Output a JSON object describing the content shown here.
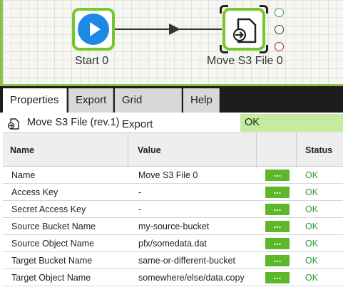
{
  "canvas": {
    "nodes": [
      {
        "label": "Start 0",
        "icon": "play-icon"
      },
      {
        "label": "Move S3 File 0",
        "icon": "move-file-icon"
      }
    ]
  },
  "tabs": [
    {
      "label": "Properties",
      "active": true
    },
    {
      "label": "Export"
    },
    {
      "label": "Grid Export"
    },
    {
      "label": "Help"
    }
  ],
  "component": {
    "title": "Move S3 File (rev.1)",
    "status": "OK"
  },
  "table": {
    "headers": {
      "name": "Name",
      "value": "Value",
      "button": "",
      "status": "Status"
    },
    "rows": [
      {
        "name": "Name",
        "value": "Move S3 File 0",
        "button": "...",
        "status": "OK"
      },
      {
        "name": "Access Key",
        "value": "-",
        "button": "...",
        "status": "OK"
      },
      {
        "name": "Secret Access Key",
        "value": "-",
        "button": "...",
        "status": "OK"
      },
      {
        "name": "Source Bucket Name",
        "value": "my-source-bucket",
        "button": "...",
        "status": "OK"
      },
      {
        "name": "Source Object Name",
        "value": "pfx/somedata.dat",
        "button": "...",
        "status": "OK"
      },
      {
        "name": "Target Bucket Name",
        "value": "same-or-different-bucket",
        "button": "...",
        "status": "OK"
      },
      {
        "name": "Target Object Name",
        "value": "somewhere/else/data.copy",
        "button": "...",
        "status": "OK"
      }
    ]
  },
  "colors": {
    "accent_green": "#8bc34a",
    "node_border": "#76c72b",
    "play_blue": "#1e88e5",
    "ok_text": "#2e9a2e",
    "ok_bg": "#c5eba0"
  }
}
